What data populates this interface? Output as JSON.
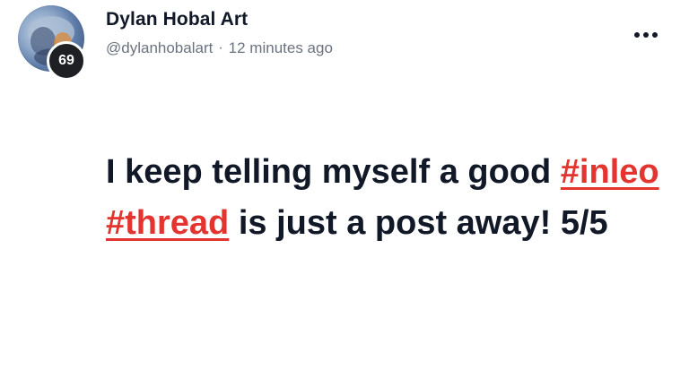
{
  "post": {
    "author_name": "Dylan Hobal Art",
    "handle": "@dylanhobalart",
    "separator": "·",
    "timestamp": "12 minutes ago",
    "reputation": "69",
    "more_icon": "more-horizontal-icon",
    "text_before": "I keep telling myself a good",
    "hashtags": [
      "#inleo",
      "#thread"
    ],
    "text_after": "is just a post away! 5/5"
  },
  "colors": {
    "hashtag": "#e3342f",
    "text": "#111827",
    "muted": "#6b7280",
    "badge": "#1f2024"
  }
}
